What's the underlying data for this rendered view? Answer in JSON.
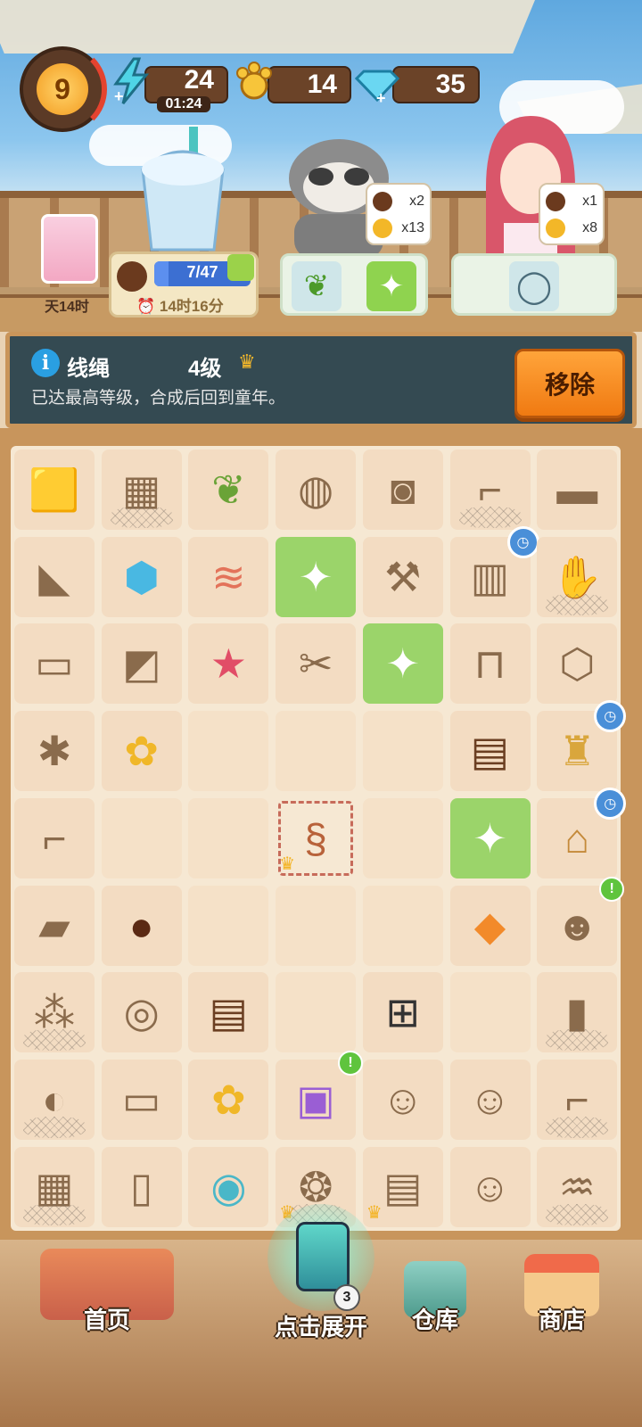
{
  "hud": {
    "level": "9",
    "energy": {
      "value": "24",
      "timer": "01:24"
    },
    "paws": "14",
    "gems": "35"
  },
  "orders": {
    "portrait_time": "天14时",
    "progress": {
      "text": "7/47",
      "fraction": 0.149,
      "time": "14时16分"
    },
    "raccoon_bubble": [
      {
        "qty": "x2"
      },
      {
        "qty": "x13"
      }
    ],
    "girl_bubble": [
      {
        "qty": "x1"
      },
      {
        "qty": "x8"
      }
    ]
  },
  "info": {
    "icon": "i",
    "item_name": "线绳",
    "item_level": "4级",
    "description": "已达最高等级，合成后回到童年。",
    "remove_label": "移除"
  },
  "board": {
    "rows": [
      [
        "cloth",
        "grill",
        "sprout",
        "jar",
        "bucket",
        "hooks",
        "plank"
      ],
      [
        "hat",
        "ice",
        "bandage",
        "spray",
        "tool",
        "vending",
        "glove"
      ],
      [
        "pipe",
        "bag",
        "starfish",
        "pliers",
        "spray",
        "stand",
        "nut"
      ],
      [
        "screw",
        "paw",
        "",
        "",
        "",
        "chocolate",
        "bag-gold"
      ],
      [
        "wrench",
        "",
        "",
        "thread",
        "",
        "spray",
        "hut"
      ],
      [
        "toothpaste",
        "beans",
        "",
        "",
        "",
        "candy",
        "raccoon-toy"
      ],
      [
        "meatballs",
        "cookies",
        "chocolate",
        "",
        "go-board",
        "",
        "jug"
      ],
      [
        "racket",
        "soap",
        "paw-cookies",
        "chest",
        "cat-keychain",
        "cat-keychain-2",
        "rack"
      ],
      [
        "grill-2",
        "battery",
        "coin",
        "fruit-basket",
        "photo-book",
        "fox-keychain",
        "bottle"
      ]
    ]
  },
  "nav": {
    "home": "首页",
    "expand": "点击展开",
    "expand_count": "3",
    "warehouse": "仓库",
    "shop": "商店"
  }
}
